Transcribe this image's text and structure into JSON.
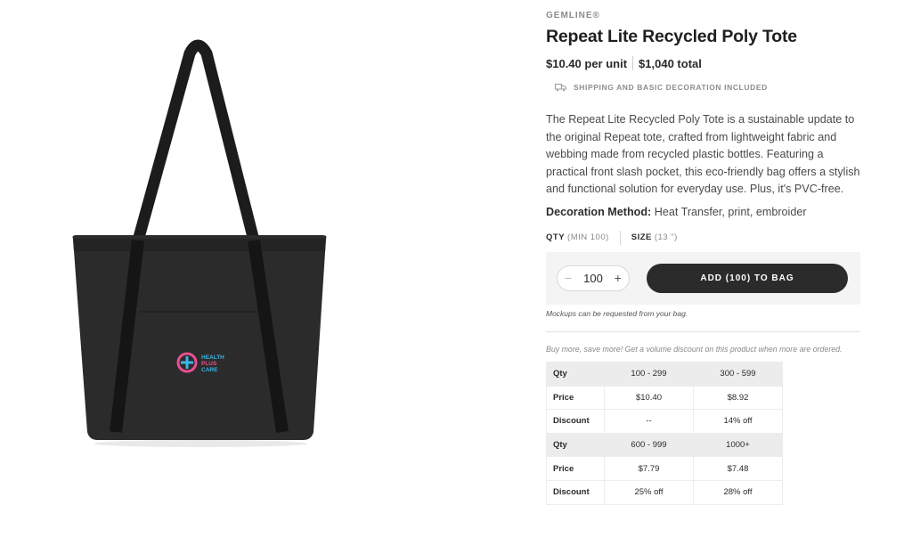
{
  "product": {
    "brand": "GEMLINE®",
    "title": "Repeat Lite Recycled Poly Tote",
    "price_unit": "$10.40 per unit",
    "price_total": "$1,040 total",
    "shipping_note": "SHIPPING AND BASIC DECORATION INCLUDED",
    "description": "The Repeat Lite Recycled Poly Tote is a sustainable update to the original Repeat tote, crafted from lightweight fabric and webbing made from recycled plastic bottles. Featuring a practical front slash pocket, this eco-friendly bag offers a stylish and functional solution for everyday use. Plus, it's PVC-free.",
    "decoration_label": "Decoration Method:",
    "decoration_value": "Heat Transfer, print, embroider",
    "logo_text": [
      "HEALTH",
      "PLUS",
      "CARE"
    ]
  },
  "options": {
    "qty_label": "QTY",
    "qty_min": "(MIN 100)",
    "size_label": "SIZE",
    "size_value": "(13 \")"
  },
  "buy": {
    "minus": "−",
    "quantity": "100",
    "plus": "+",
    "add_button": "ADD (100) TO BAG",
    "mockup_note": "Mockups can be requested from your bag."
  },
  "volume": {
    "note": "Buy more, save more! Get a volume discount on this product when more are ordered.",
    "rows": [
      {
        "type": "head",
        "label": "Qty",
        "a": "100 - 299",
        "b": "300 - 599"
      },
      {
        "type": "row",
        "label": "Price",
        "a": "$10.40",
        "b": "$8.92"
      },
      {
        "type": "row",
        "label": "Discount",
        "a": "--",
        "b": "14% off"
      },
      {
        "type": "head",
        "label": "Qty",
        "a": "600 - 999",
        "b": "1000+"
      },
      {
        "type": "row",
        "label": "Price",
        "a": "$7.79",
        "b": "$7.48"
      },
      {
        "type": "row",
        "label": "Discount",
        "a": "25% off",
        "b": "28% off"
      }
    ]
  },
  "colors": {
    "bag": "#2a2a2a",
    "button": "#2b2b2b",
    "logo_pink": "#e8508f",
    "logo_blue": "#3bb5e8"
  }
}
